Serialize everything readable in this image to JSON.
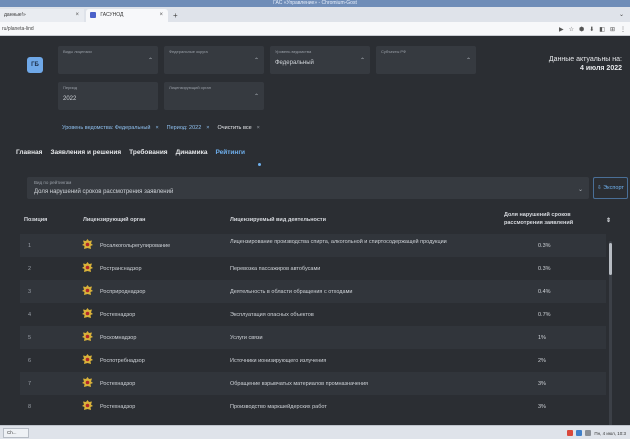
{
  "os": {
    "window_title": "ГАС «Управление» - Chromium-Gost"
  },
  "browser": {
    "tabs": [
      {
        "label": "данные!»",
        "close": "×"
      },
      {
        "label": "ГАСУНОД",
        "close": "×"
      }
    ],
    "new_tab": "+",
    "tab_menu": "⌄",
    "address": "ru/planeta-lind",
    "toolbar_icons": [
      "▶",
      "☆",
      "⬢",
      "⬇",
      "◧",
      "⊞",
      "⋮"
    ]
  },
  "app": {
    "logo": "ГБ",
    "filters": [
      {
        "label": "Виды лицензии",
        "value": ""
      },
      {
        "label": "Федеральные округа",
        "value": ""
      },
      {
        "label": "Уровень ведомства",
        "value": "Федеральный"
      },
      {
        "label": "Субъекты РФ",
        "value": ""
      },
      {
        "label": "Период",
        "value": "2022"
      },
      {
        "label": "Лицензирующий орган",
        "value": ""
      }
    ],
    "updated_label": "Данные актуальны на:",
    "updated_date": "4 июля 2022",
    "chips": [
      {
        "label": "Уровень ведомства: Федеральный",
        "close": "×"
      },
      {
        "label": "Период: 2022",
        "close": "×"
      }
    ],
    "clear_all": "Очистить все",
    "clear_close": "×",
    "nav": [
      "Главная",
      "Заявления и решения",
      "Требования",
      "Динамика",
      "Рейтинги"
    ],
    "rating_type_label": "Вид по рейтингам",
    "rating_type_value": "Доля нарушений сроков рассмотрения заявлений",
    "export_label": "⇩ Экспорт",
    "table": {
      "headers": {
        "position": "Позиция",
        "org": "Лицензирующий орган",
        "activity": "Лицензируемый вид деятельности",
        "share": "Доля нарушений сроков рассмотрения заявлений",
        "sort": "⇕"
      },
      "rows": [
        {
          "pos": "1",
          "org": "Росалкогольрегулирование",
          "activity": "Лицензирование производства спирта, алкогольной и спиртосодержащей продукции",
          "share": "0.3%"
        },
        {
          "pos": "2",
          "org": "Ространснадзор",
          "activity": "Перевозка пассажиров автобусами",
          "share": "0.3%"
        },
        {
          "pos": "3",
          "org": "Росприроднадзор",
          "activity": "Деятельность в области обращения с отходами",
          "share": "0.4%"
        },
        {
          "pos": "4",
          "org": "Ростехнадзор",
          "activity": "Эксплуатация опасных объектов",
          "share": "0.7%"
        },
        {
          "pos": "5",
          "org": "Роскомнадзор",
          "activity": "Услуги связи",
          "share": "1%"
        },
        {
          "pos": "6",
          "org": "Роспотребнадзор",
          "activity": "Источники ионизирующего излучения",
          "share": "2%"
        },
        {
          "pos": "7",
          "org": "Ростехнадзор",
          "activity": "Обращение взрывчатых материалов промназначения",
          "share": "3%"
        },
        {
          "pos": "8",
          "org": "Ростехнадзор",
          "activity": "Производство маркшейдерских работ",
          "share": "3%"
        }
      ]
    }
  },
  "taskbar": {
    "start": "Ch...",
    "clock": "Пн, 4 июл, 10:3"
  }
}
